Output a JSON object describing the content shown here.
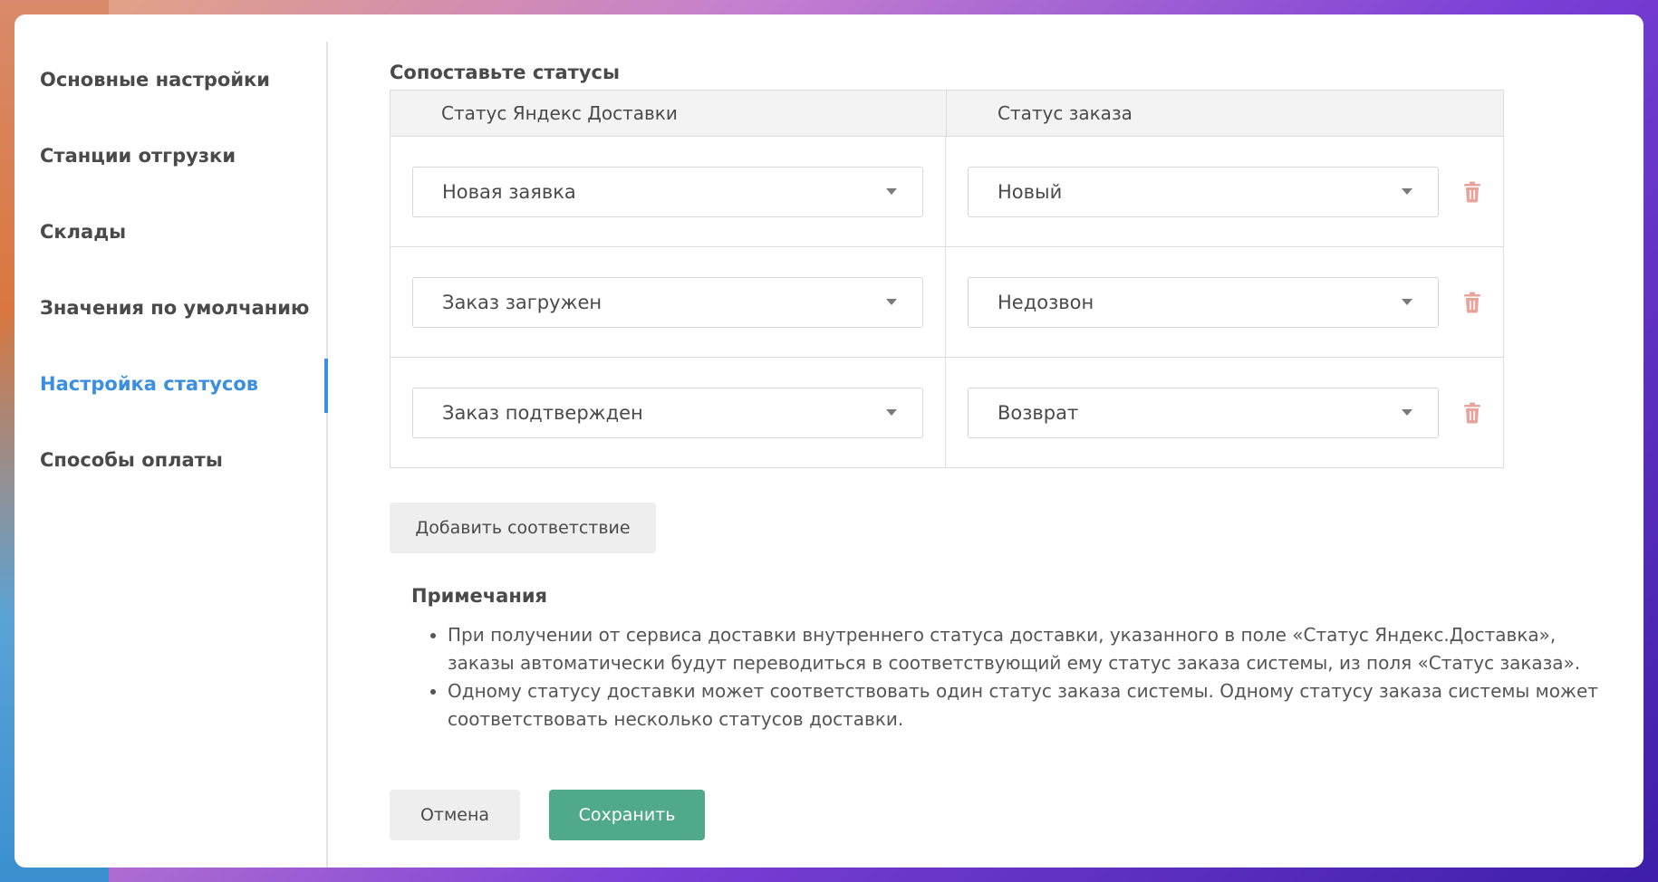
{
  "sidebar": {
    "items": [
      {
        "label": "Основные настройки",
        "active": false
      },
      {
        "label": "Станции отгрузки",
        "active": false
      },
      {
        "label": "Склады",
        "active": false
      },
      {
        "label": "Значения по умолчанию",
        "active": false
      },
      {
        "label": "Настройка статусов",
        "active": true
      },
      {
        "label": "Способы оплаты",
        "active": false
      }
    ],
    "active_color": "#3b8fe0"
  },
  "main": {
    "title": "Сопоставьте статусы",
    "table": {
      "headers": [
        "Статус Яндекс Доставки",
        "Статус заказа"
      ],
      "rows": [
        {
          "delivery_status": "Новая заявка",
          "order_status": "Новый"
        },
        {
          "delivery_status": "Заказ загружен",
          "order_status": "Недозвон"
        },
        {
          "delivery_status": "Заказ подтвержден",
          "order_status": "Возврат"
        }
      ]
    },
    "add_button": "Добавить соответствие",
    "notes": {
      "title": "Примечания",
      "items": [
        "При получении от сервиса доставки внутреннего статуса доставки, указанного в поле «Статус Яндекс.Доставка», заказы автоматически будут переводиться в соответствующий ему статус заказа системы, из поля «Статус заказа».",
        "Одному статусу доставки может соответствовать один статус заказа системы. Одному статусу заказа системы может соответствовать несколько статусов доставки."
      ]
    },
    "cancel_button": "Отмена",
    "save_button": "Сохранить"
  },
  "colors": {
    "accent": "#3b8fe0",
    "save": "#4fa98a",
    "delete_icon": "#e8a39a"
  }
}
